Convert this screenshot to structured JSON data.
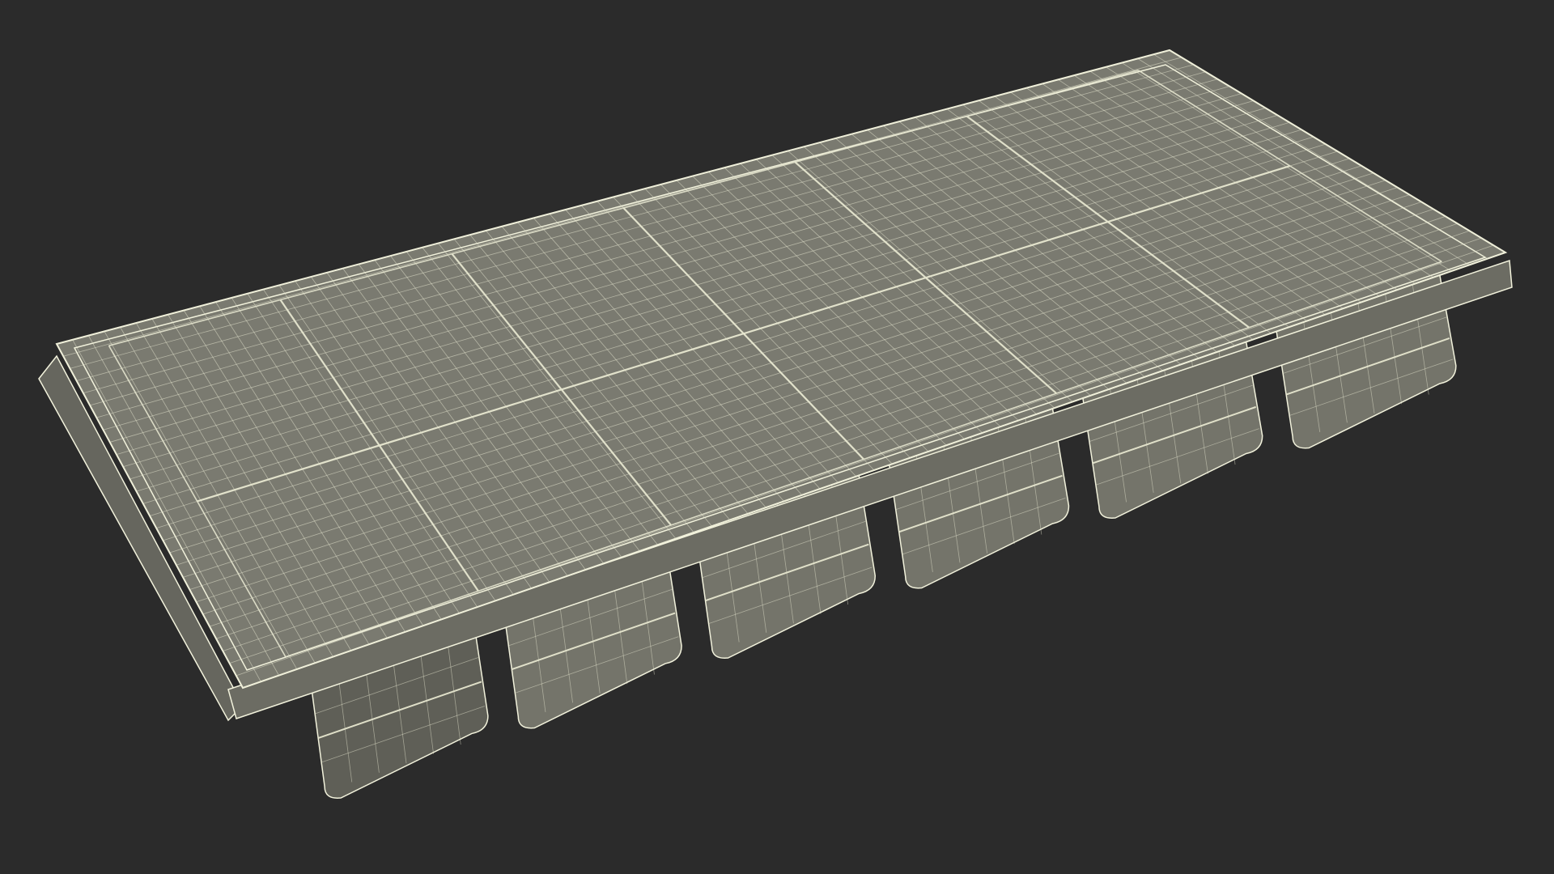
{
  "scene": {
    "subject": "ice-cube-tray-wireframe",
    "background_color": "#2b2b2b",
    "surface_color": "#7a7a70",
    "surface_dark_color": "#5f5f57",
    "wire_color": "#e6e6cf",
    "outline_color": "#f2f2dc",
    "cube_count": 12
  }
}
